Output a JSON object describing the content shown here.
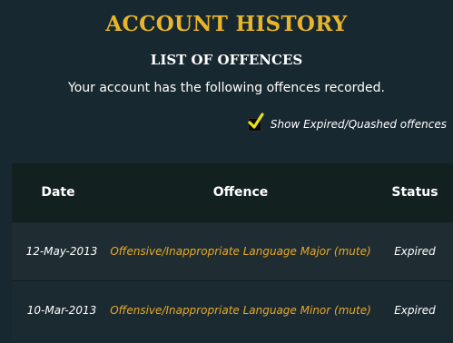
{
  "header": {
    "title": "ACCOUNT HISTORY",
    "section_title": "LIST OF OFFENCES",
    "subtitle": "Your account has the following offences recorded."
  },
  "filter": {
    "show_expired_label": "Show Expired/Quashed offences",
    "show_expired_checked": true
  },
  "table": {
    "columns": [
      "Date",
      "Offence",
      "Status"
    ],
    "rows": [
      {
        "date": "12-May-2013",
        "offence": "Offensive/Inappropriate Language Major (mute)",
        "status": "Expired"
      },
      {
        "date": "10-Mar-2013",
        "offence": "Offensive/Inappropriate Language Minor (mute)",
        "status": "Expired"
      }
    ]
  },
  "colors": {
    "background": "#182830",
    "accent_gold": "#e8b52a",
    "offence_text": "#e8a825",
    "checkmark": "#e8e019"
  },
  "icons": {
    "checkbox": "checkmark-icon"
  }
}
